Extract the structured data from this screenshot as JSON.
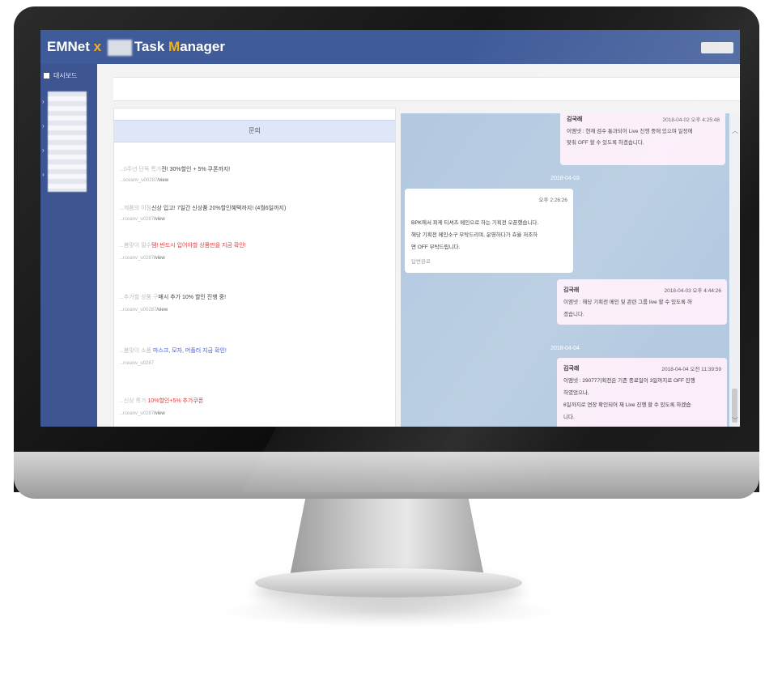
{
  "app": {
    "brand_prefix": "EMNet",
    "brand_x": " x ",
    "brand_task": "Task ",
    "brand_m": "M",
    "brand_rest": "anager"
  },
  "sidebar": {
    "dashboard_label": "대시보드",
    "arrow": "›"
  },
  "notices": {
    "header": "문의",
    "items": [
      {
        "prefix": "...0주년 단독 특가",
        "title": "전! 30%할인 + 5% 쿠폰까지!",
        "link": "...sceanv_u00287",
        "view": "/view",
        "style": "normal"
      },
      {
        "prefix": "...제품의 이점",
        "title": "신상 입고! 7일간 신상품 20%할인혜택까지! (4월6일까지)",
        "link": "...rceanv_u0287",
        "view": "/view",
        "style": "normal"
      },
      {
        "prefix": "...봄맞이 필수",
        "title": "템! 반드시 입어야할 상품만을 지금 확인!",
        "link": "...rceanv_u0287",
        "view": "/view",
        "style": "red"
      },
      {
        "prefix": "...추가할 상품 구",
        "title": "매시 추가 10% 할인 진행 중!",
        "link": "...rceanv_u00287",
        "view": "/view",
        "style": "normal"
      },
      {
        "prefix": "...봄맞이 소품 ",
        "title": "마스크, 모자, 머플러 지금 확인!",
        "link": "...rceanv_u0287",
        "view": "/view",
        "style": "blue"
      },
      {
        "prefix": "...신상 특가 ",
        "title": "10%할인+5% 추가쿠폰",
        "link": "...rceanv_u0287",
        "view": "/view",
        "style": "red"
      }
    ]
  },
  "chat": {
    "messages": [
      {
        "name": "김국래",
        "timestamp": "2018-04-02 오후 4:25:48",
        "lines": [
          "이엠넷 : 현재 검수 통과되어 Live 진행 중에 있으며 일정에",
          "맞춰 OFF 할 수 있도록 하겠습니다."
        ],
        "style": "pink"
      },
      {
        "date": "2018-04-03"
      },
      {
        "name": "",
        "timestamp": "오후 2:26:26",
        "lines": [
          "BPK에서 피케 티셔츠 메인으로 하는 기획전 오픈했습니다.",
          "해당 기획전 메인소구 부탁드리며, 운영하다가 효율 저조하",
          "면 OFF 부탁드립니다."
        ],
        "footer": "답변완료",
        "style": "white"
      },
      {
        "name": "김국래",
        "timestamp": "2018-04-03 오후 4:44:26",
        "lines": [
          "이엠넷 : 해당 기획전 메인 및 관련 그룹 live 할 수 있도록 하",
          "겠습니다."
        ],
        "style": "pink"
      },
      {
        "date": "2018-04-04"
      },
      {
        "name": "김국래",
        "timestamp": "2018-04-04 오전 11:39:59",
        "lines": [
          "이엠넷 : 29077기획전은 기존 종료일이 3일까지로 OFF 진행",
          "하였었으나,",
          "6일까지로 연장 확인되어 재 Live 진행 할 수 있도록 하겠습",
          "니다."
        ],
        "style": "pink"
      }
    ]
  },
  "colors": {
    "topbar": "#3f5b9a",
    "sidebar": "#3d5592",
    "accent": "#f2b01e",
    "chat_bg": "#b3c9e0",
    "pink_bubble": "#fbeefa"
  }
}
